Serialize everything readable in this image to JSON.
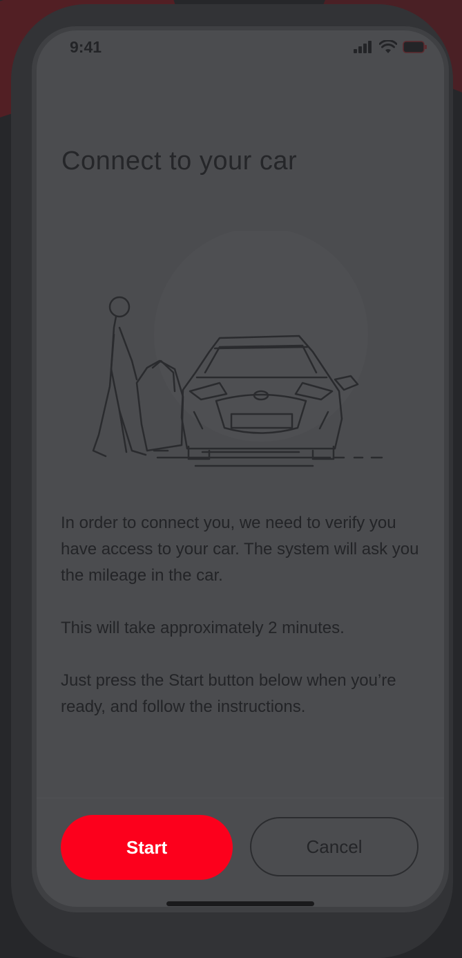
{
  "status_bar": {
    "time": "9:41",
    "icons": [
      "cellular-signal-icon",
      "wifi-icon",
      "battery-icon"
    ]
  },
  "page": {
    "title": "Connect to your car"
  },
  "illustration": {
    "subject": "car-with-person-opening-door-illustration"
  },
  "body": {
    "paragraph_1": "In order to connect you, we need to verify you have access to your car. The system will ask you the mileage in the car.",
    "paragraph_2": "This will take approximately 2 minutes.",
    "paragraph_3": "Just press the Start button below when you’re ready, and follow the instructions."
  },
  "actions": {
    "start_label": "Start",
    "cancel_label": "Cancel"
  },
  "colors": {
    "accent": "#fc001c",
    "background": "#26272a",
    "screen": "#4b4c4f",
    "text": "#232427"
  }
}
